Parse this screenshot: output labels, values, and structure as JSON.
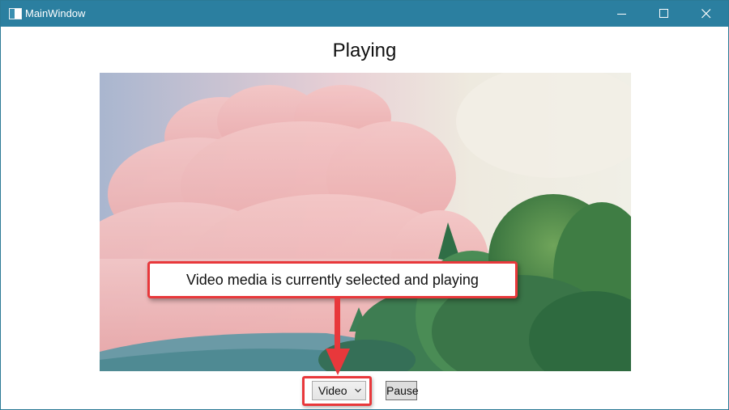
{
  "window": {
    "title": "MainWindow",
    "titlebar_color": "#2b7fa0",
    "controls": [
      "minimize-icon",
      "maximize-icon",
      "close-icon"
    ]
  },
  "main": {
    "status_heading": "Playing"
  },
  "video": {
    "content": "video-frame"
  },
  "callout": {
    "text": "Video media is currently selected and playing",
    "border_color": "#e8383b"
  },
  "controls": {
    "media_select": {
      "selected": "Video"
    },
    "pause_label": "Pause"
  }
}
